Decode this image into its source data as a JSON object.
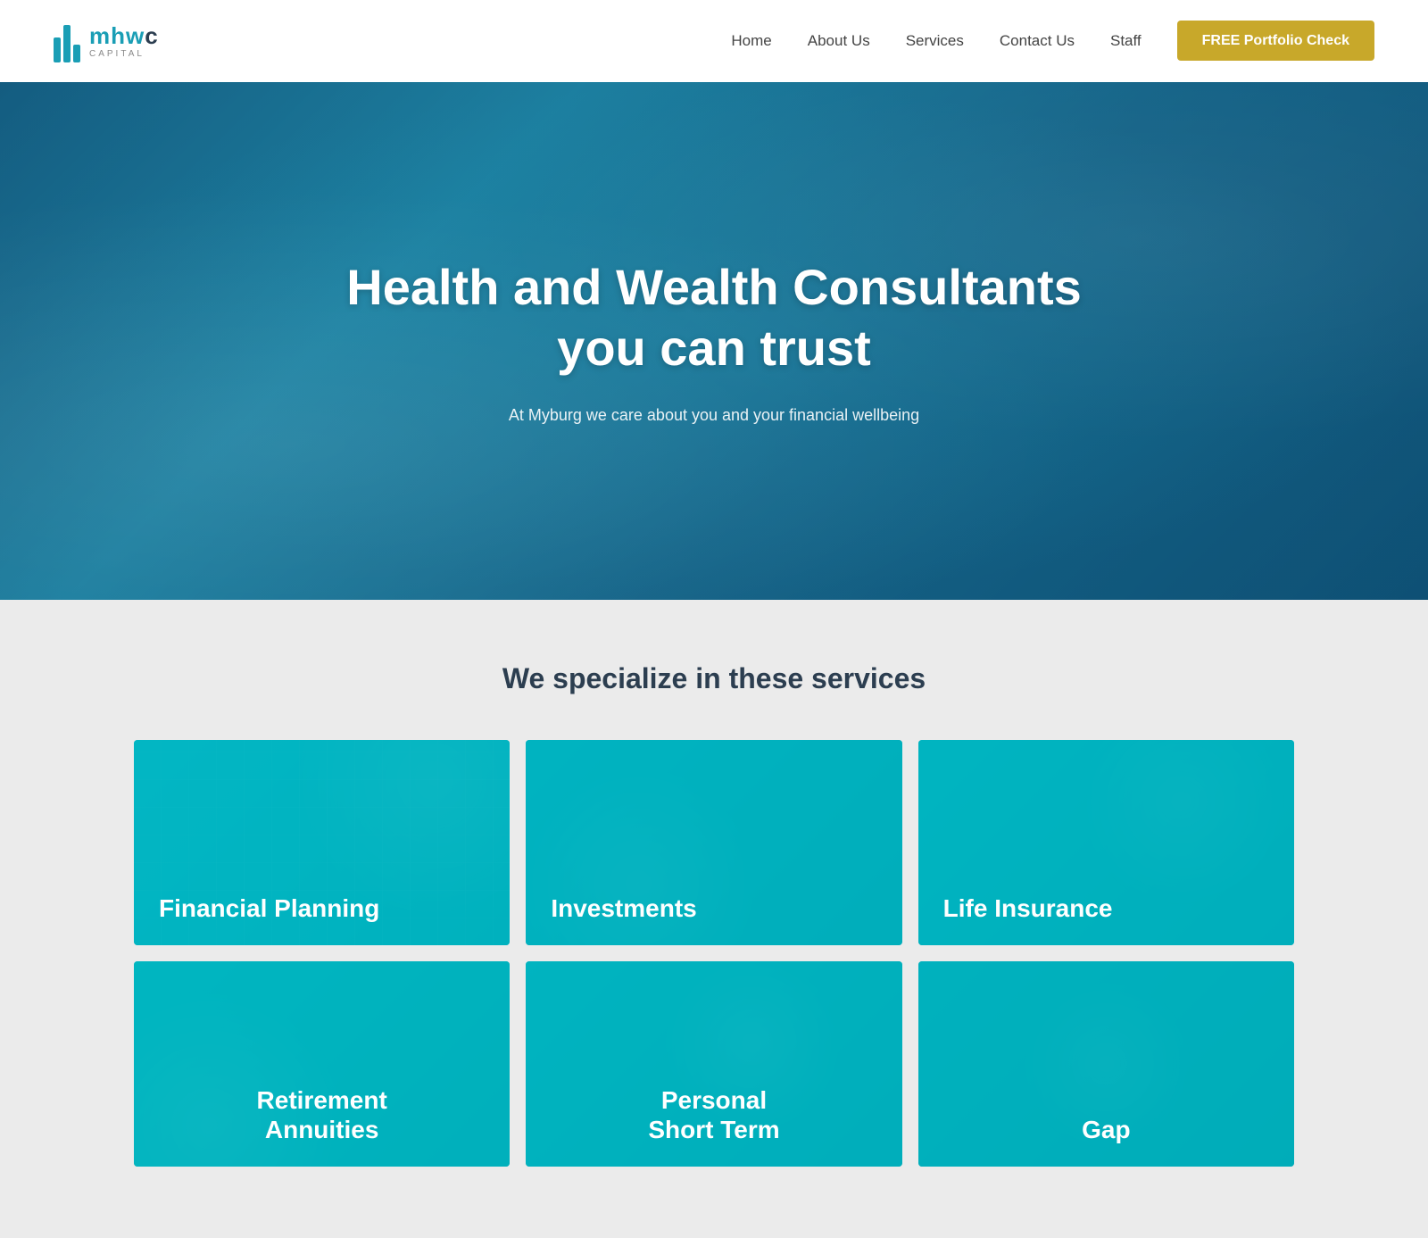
{
  "navbar": {
    "logo_text": "mhwc",
    "logo_sub": "CAPITAL",
    "nav_items": [
      {
        "label": "Home",
        "href": "#"
      },
      {
        "label": "About Us",
        "href": "#"
      },
      {
        "label": "Services",
        "href": "#"
      },
      {
        "label": "Contact Us",
        "href": "#"
      },
      {
        "label": "Staff",
        "href": "#"
      }
    ],
    "cta_label": "FREE Portfolio Check"
  },
  "hero": {
    "title_line1": "Health and Wealth Consultants",
    "title_line2": "you can trust",
    "subtitle": "At Myburg we care about you and your financial wellbeing"
  },
  "services": {
    "heading": "We specialize in these services",
    "cards": [
      {
        "id": "financial-planning",
        "label": "Financial Planning",
        "css_class": "financial-planning"
      },
      {
        "id": "investments",
        "label": "Investments",
        "css_class": "investments"
      },
      {
        "id": "life-insurance",
        "label": "Life Insurance",
        "css_class": "life-insurance"
      },
      {
        "id": "retirement",
        "label": "Retirement\nAnnuities",
        "css_class": "retirement",
        "line1": "Retirement",
        "line2": "Annuities"
      },
      {
        "id": "personal-short-term",
        "label": "Personal\nShort Term",
        "css_class": "personal-short-term",
        "line1": "Personal",
        "line2": "Short Term"
      },
      {
        "id": "gap",
        "label": "Gap",
        "css_class": "gap"
      }
    ]
  }
}
